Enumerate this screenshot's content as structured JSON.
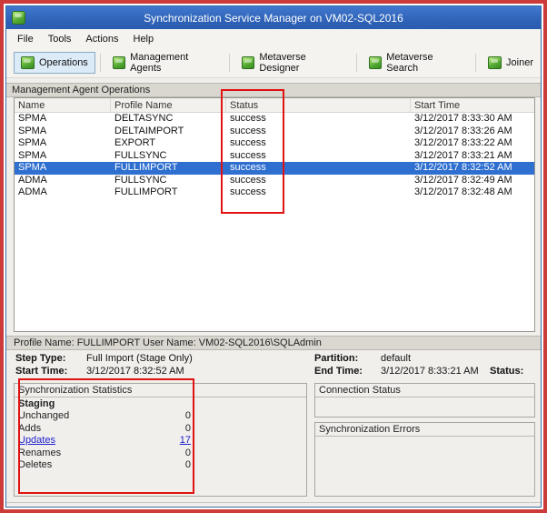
{
  "colors": {
    "titlebar_blue": "#2f63b8",
    "selection_blue": "#2e6fd0",
    "annotation_red": "#e01212",
    "icon_green": "#53a933"
  },
  "window": {
    "title": "Synchronization Service Manager on VM02-SQL2016"
  },
  "menu": {
    "items": [
      "File",
      "Tools",
      "Actions",
      "Help"
    ]
  },
  "toolbar": {
    "buttons": [
      {
        "label": "Operations",
        "selected": true
      },
      {
        "label": "Management Agents",
        "selected": false
      },
      {
        "label": "Metaverse Designer",
        "selected": false
      },
      {
        "label": "Metaverse Search",
        "selected": false
      },
      {
        "label": "Joiner",
        "selected": false
      }
    ]
  },
  "operations": {
    "section_title": "Management Agent Operations",
    "columns": [
      "Name",
      "Profile Name",
      "Status",
      "Start Time"
    ],
    "rows": [
      {
        "name": "SPMA",
        "profile": "DELTASYNC",
        "status": "success",
        "start": "3/12/2017 8:33:30 AM"
      },
      {
        "name": "SPMA",
        "profile": "DELTAIMPORT",
        "status": "success",
        "start": "3/12/2017 8:33:26 AM"
      },
      {
        "name": "SPMA",
        "profile": "EXPORT",
        "status": "success",
        "start": "3/12/2017 8:33:22 AM"
      },
      {
        "name": "SPMA",
        "profile": "FULLSYNC",
        "status": "success",
        "start": "3/12/2017 8:33:21 AM"
      },
      {
        "name": "SPMA",
        "profile": "FULLIMPORT",
        "status": "success",
        "start": "3/12/2017 8:32:52 AM"
      },
      {
        "name": "ADMA",
        "profile": "FULLSYNC",
        "status": "success",
        "start": "3/12/2017 8:32:49 AM"
      },
      {
        "name": "ADMA",
        "profile": "FULLIMPORT",
        "status": "success",
        "start": "3/12/2017 8:32:48 AM"
      }
    ]
  },
  "details": {
    "header": "Profile Name: FULLIMPORT  User Name: VM02-SQL2016\\SQLAdmin",
    "step_type_label": "Step Type:",
    "step_type": "Full Import (Stage Only)",
    "start_time_label": "Start Time:",
    "start_time": "3/12/2017 8:32:52 AM",
    "partition_label": "Partition:",
    "partition": "default",
    "end_time_label": "End Time:",
    "end_time": "3/12/2017 8:33:21 AM",
    "status_label": "Status:"
  },
  "statistics": {
    "title": "Synchronization Statistics",
    "group": "Staging",
    "items": [
      {
        "label": "Unchanged",
        "value": "0",
        "link": false
      },
      {
        "label": "Adds",
        "value": "0",
        "link": false
      },
      {
        "label": "Updates",
        "value": "17",
        "link": true
      },
      {
        "label": "Renames",
        "value": "0",
        "link": false
      },
      {
        "label": "Deletes",
        "value": "0",
        "link": false
      }
    ]
  },
  "connection_status": {
    "title": "Connection Status"
  },
  "sync_errors": {
    "title": "Synchronization Errors"
  }
}
